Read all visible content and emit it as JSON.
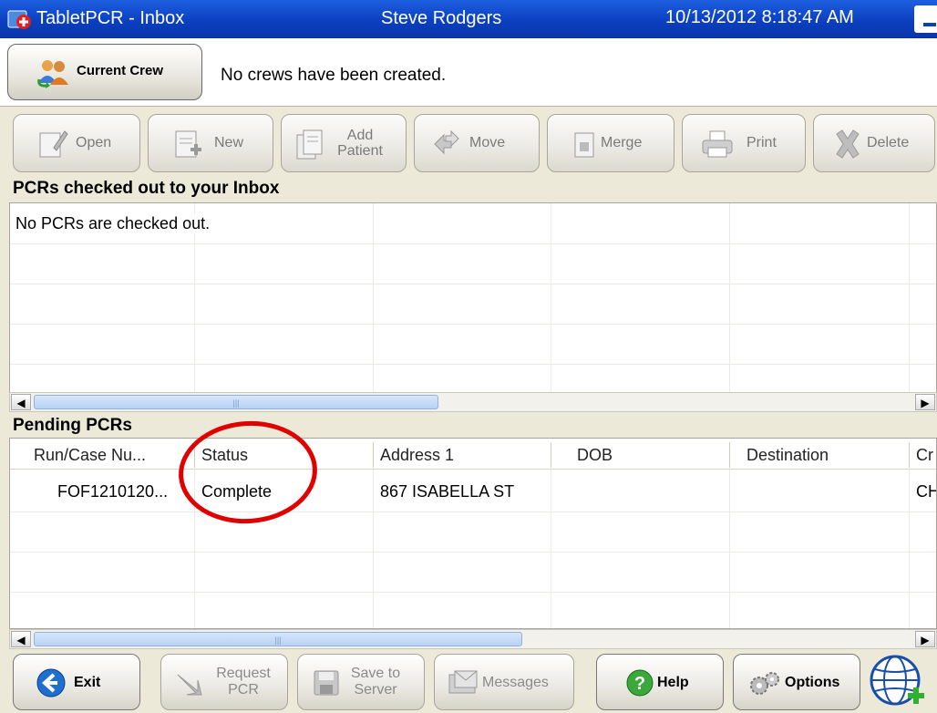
{
  "titlebar": {
    "title": "TabletPCR - Inbox",
    "user": "Steve Rodgers",
    "datetime": "10/13/2012 8:18:47 AM"
  },
  "crew": {
    "button_label": "Current Crew",
    "message": "No crews have been created."
  },
  "toolbar": {
    "open": "Open",
    "new": "New",
    "add_patient_line1": "Add",
    "add_patient_line2": "Patient",
    "move": "Move",
    "merge": "Merge",
    "print": "Print",
    "delete": "Delete"
  },
  "inbox": {
    "heading": "PCRs checked out to your Inbox",
    "empty_message": "No PCRs are checked out."
  },
  "pending": {
    "heading": "Pending PCRs",
    "columns": [
      "Run/Case Nu...",
      "Status",
      "Address 1",
      "DOB",
      "Destination",
      "Cr"
    ],
    "rows": [
      [
        "FOF1210120...",
        "Complete",
        "867 ISABELLA ST",
        "",
        "",
        "CH"
      ]
    ]
  },
  "bottom": {
    "exit": "Exit",
    "request_line1": "Request",
    "request_line2": "PCR",
    "save_line1": "Save to",
    "save_line2": "Server",
    "messages": "Messages",
    "help": "Help",
    "options": "Options"
  },
  "colors": {
    "titlebar": "#0b3fc1",
    "annotation": "#e00000",
    "scroll_thumb": "#b8d2f4"
  }
}
